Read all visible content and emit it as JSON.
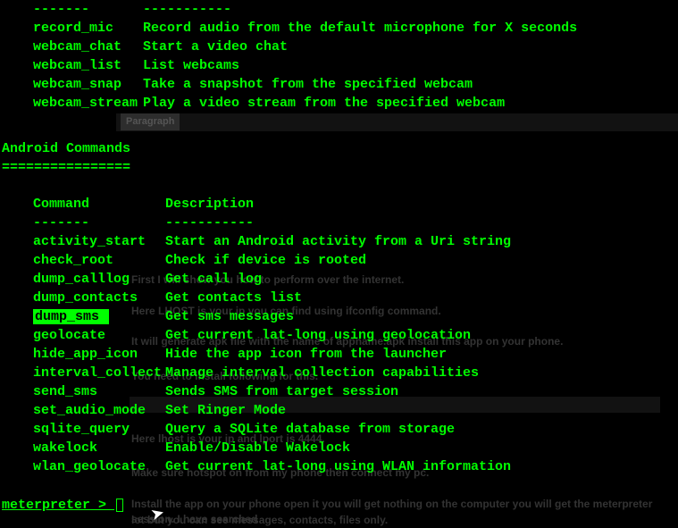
{
  "stdapi": {
    "separator1": "-------",
    "separator2": "-----------",
    "rows": [
      {
        "cmd": "record_mic",
        "desc": "Record audio from the default microphone for X seconds"
      },
      {
        "cmd": "webcam_chat",
        "desc": "Start a video chat"
      },
      {
        "cmd": "webcam_list",
        "desc": "List webcams"
      },
      {
        "cmd": "webcam_snap",
        "desc": "Take a snapshot from the specified webcam"
      },
      {
        "cmd": "webcam_stream",
        "desc": "Play a video stream from the specified webcam"
      }
    ]
  },
  "android": {
    "title": "Android Commands",
    "underline": "================",
    "header_cmd": "Command",
    "header_desc": "Description",
    "sep_cmd": "-------",
    "sep_desc": "-----------",
    "rows": [
      {
        "cmd": "activity_start",
        "desc": "Start an Android activity from a Uri string",
        "hl": false
      },
      {
        "cmd": "check_root",
        "desc": "Check if device is rooted",
        "hl": false
      },
      {
        "cmd": "dump_calllog",
        "desc": "Get call log",
        "hl": false
      },
      {
        "cmd": "dump_contacts",
        "desc": "Get contacts list",
        "hl": false
      },
      {
        "cmd": "dump_sms",
        "desc": "Get sms messages",
        "hl": true
      },
      {
        "cmd": "geolocate",
        "desc": "Get current lat-long using geolocation",
        "hl": false
      },
      {
        "cmd": "hide_app_icon",
        "desc": "Hide the app icon from the launcher",
        "hl": false
      },
      {
        "cmd": "interval_collect",
        "desc": "Manage interval collection capabilities",
        "hl": false
      },
      {
        "cmd": "send_sms",
        "desc": "Sends SMS from target session",
        "hl": false
      },
      {
        "cmd": "set_audio_mode",
        "desc": "Set Ringer Mode",
        "hl": false
      },
      {
        "cmd": "sqlite_query",
        "desc": "Query a SQLite database from storage",
        "hl": false
      },
      {
        "cmd": "wakelock",
        "desc": "Enable/Disable Wakelock",
        "hl": false
      },
      {
        "cmd": "wlan_geolocate",
        "desc": "Get current lat-long using WLAN information",
        "hl": false
      }
    ]
  },
  "prompt": {
    "text": "meterpreter",
    "arrow": " > "
  },
  "background": {
    "paragraph_label": "Paragraph",
    "line1": "First I will show you how to perform over the internet.",
    "line2": "Here LHOST is your ip you can find using ifconfig command.",
    "line3": "It will generate apk file with the name of appname.apk install this app on your phone.",
    "line4": "You need to install following for this.",
    "line5": "Here lhost is your ip and lport is 4444.",
    "line6": "Make sure hotspot on from my phone then connect my pc.",
    "line7": "Install the app on your phone open it you will get nothing on the computer you will get the meterpreter session. I have searched",
    "line8": "lot but you can see messages, contacts, files only."
  }
}
